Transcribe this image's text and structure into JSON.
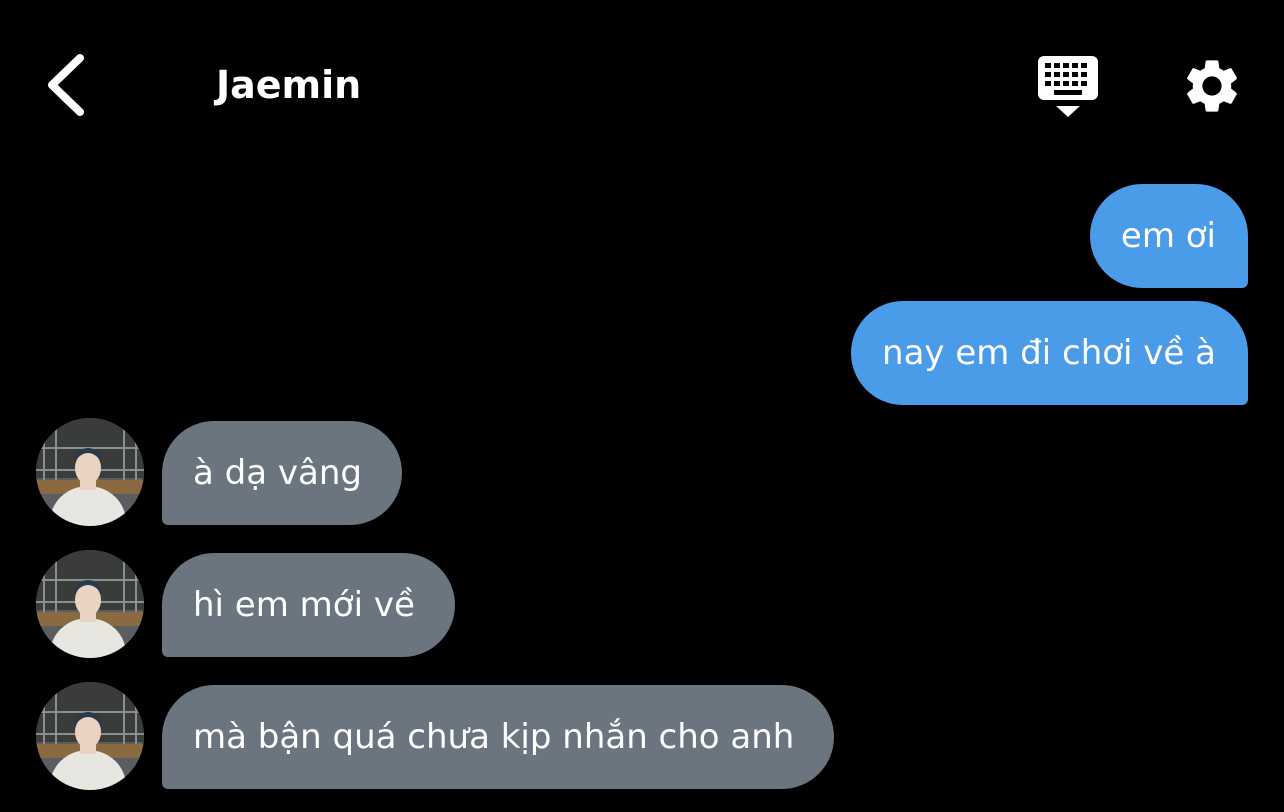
{
  "header": {
    "back_icon": "chevron-left-icon",
    "title": "Jaemin",
    "keyboard_icon": "keyboard-icon",
    "settings_icon": "gear-icon"
  },
  "colors": {
    "background": "#000000",
    "outgoing_bubble": "#4a9be8",
    "incoming_bubble": "#6a7580",
    "text": "#ffffff"
  },
  "messages": [
    {
      "direction": "outgoing",
      "text": "em ơi"
    },
    {
      "direction": "outgoing",
      "text": "nay em đi chơi về à"
    },
    {
      "direction": "incoming",
      "text": "à dạ vâng"
    },
    {
      "direction": "incoming",
      "text": "hì em mới về"
    },
    {
      "direction": "incoming",
      "text": "mà bận quá chưa kịp nhắn cho anh"
    }
  ]
}
